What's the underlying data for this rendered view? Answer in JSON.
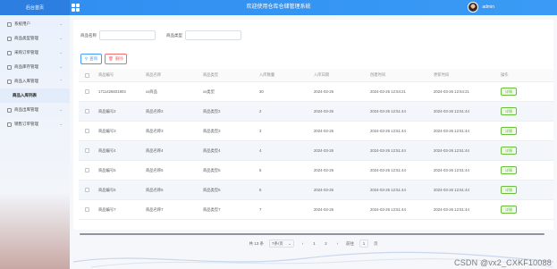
{
  "header": {
    "logo_text": "后台首页",
    "title": "欢迎使用仓库仓储管理系统",
    "username": "admin"
  },
  "sidebar": {
    "items": [
      {
        "label": "系统用户",
        "expandable": true
      },
      {
        "label": "商品类型管理",
        "expandable": true
      },
      {
        "label": "采购订单管理",
        "expandable": true
      },
      {
        "label": "商品库存管理",
        "expandable": true
      },
      {
        "label": "商品入库管理",
        "expandable": true
      },
      {
        "label": "商品入库列表",
        "expandable": false,
        "active": true
      },
      {
        "label": "商品出库管理",
        "expandable": true
      },
      {
        "label": "销售订单管理",
        "expandable": true
      }
    ]
  },
  "search": {
    "name_label": "商品名称",
    "type_label": "商品类型",
    "search_button": "查询",
    "delete_button": "删除"
  },
  "table": {
    "columns": [
      "商品编号",
      "商品名称",
      "商品类型",
      "入库数量",
      "入库日期",
      "创建时间",
      "更新时间",
      "操作"
    ],
    "rows": [
      [
        "1711426831903",
        "xx商品",
        "xx类型",
        "30",
        "2024-03-26",
        "2024-03-26 12:54:21",
        "2024-03-26 12:54:21"
      ],
      [
        "商品编号2",
        "商品名称2",
        "商品类型2",
        "2",
        "2024-03-26",
        "2024-03-26 12:51:44",
        "2024-03-26 12:51:44"
      ],
      [
        "商品编号3",
        "商品名称3",
        "商品类型3",
        "3",
        "2024-03-26",
        "2024-03-26 12:51:44",
        "2024-03-26 12:51:44"
      ],
      [
        "商品编号4",
        "商品名称4",
        "商品类型4",
        "4",
        "2024-03-26",
        "2024-03-26 12:51:44",
        "2024-03-26 12:51:44"
      ],
      [
        "商品编号5",
        "商品名称5",
        "商品类型5",
        "5",
        "2024-03-26",
        "2024-03-26 12:51:44",
        "2024-03-26 12:51:44"
      ],
      [
        "商品编号6",
        "商品名称6",
        "商品类型6",
        "6",
        "2024-03-26",
        "2024-03-26 12:51:44",
        "2024-03-26 12:51:44"
      ],
      [
        "商品编号7",
        "商品名称7",
        "商品类型7",
        "7",
        "2024-03-26",
        "2024-03-26 12:51:44",
        "2024-03-26 12:51:44"
      ]
    ],
    "action_label": "详情"
  },
  "pagination": {
    "total": "共 13 条",
    "page_size": "7条/页",
    "prev": "‹",
    "pages": [
      "1",
      "2"
    ],
    "current": "1",
    "next": "›",
    "goto_label": "前往",
    "goto_value": "1",
    "page_unit": "页"
  },
  "watermark": "CSDN @vx2_CXKF10088",
  "colors": {
    "header": "#2f8df0",
    "primary": "#409eff",
    "danger": "#f56c6c",
    "success": "#67c23a"
  }
}
